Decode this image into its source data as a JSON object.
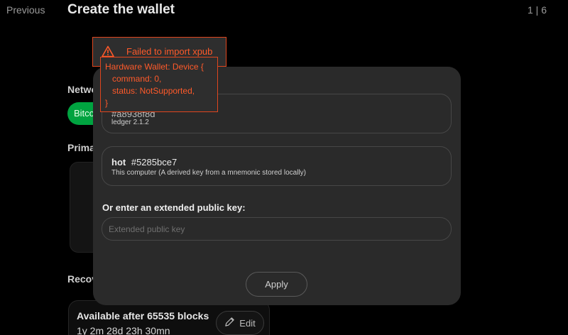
{
  "header": {
    "previous_label": "Previous",
    "title": "Create the wallet",
    "step": "1 | 6"
  },
  "background": {
    "network_label": "Netwo",
    "network_value": "Bitco",
    "primary_label": "Prima",
    "recovery_label": "Recov",
    "recovery_title": "Available after 65535 blocks",
    "recovery_sub": "1y 2m 28d 23h 30mn",
    "edit_label": "Edit"
  },
  "modal": {
    "ledger": {
      "fingerprint": "#a8938f8d",
      "sub": "ledger  2.1.2"
    },
    "hot": {
      "name": "hot",
      "fingerprint": "#5285bce7",
      "sub": "This computer  (A derived key from a mnemonic stored locally)"
    },
    "xpub_label": "Or enter an extended public key:",
    "xpub_placeholder": "Extended public key",
    "xpub_value": "",
    "apply_label": "Apply"
  },
  "error": {
    "title": "Failed to import xpub",
    "detail": "Hardware Wallet: Device {\n   command: 0,\n   status: NotSupported,\n}"
  },
  "colors": {
    "accent_green": "#00a340",
    "error": "#ff5a2a"
  },
  "icons": [
    "warning-icon",
    "pencil-icon"
  ]
}
